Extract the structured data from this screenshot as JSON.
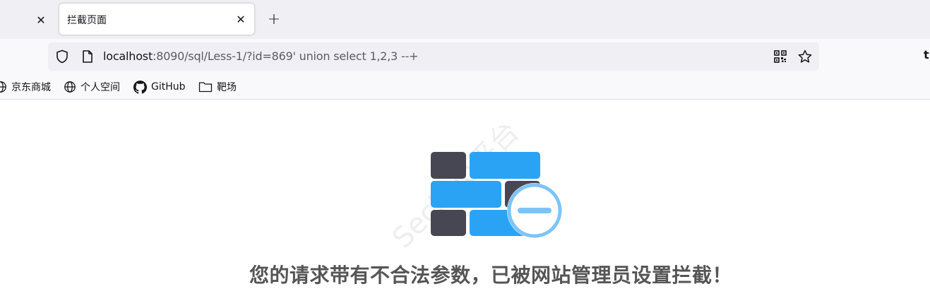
{
  "browser": {
    "tabs": [
      {
        "title": "拦截页面",
        "active": true
      }
    ],
    "url": {
      "host": "localhost",
      "rest": ":8090/sql/Less-1/?id=869' union select 1,2,3 --+"
    },
    "bookmarks": [
      {
        "label": "京东商城",
        "icon": "globe-icon"
      },
      {
        "label": "个人空间",
        "icon": "globe-icon"
      },
      {
        "label": "GitHub",
        "icon": "github-icon"
      },
      {
        "label": "靶场",
        "icon": "folder-icon"
      }
    ]
  },
  "page": {
    "watermark": "SecHub平台",
    "message": "您的请求带有不合法参数，已被网站管理员设置拦截！",
    "illustration": "firewall-block-icon"
  },
  "colors": {
    "accent_blue": "#2aa3f5",
    "dark_brick": "#474754",
    "badge_ring": "#7cc4f8",
    "message_text": "#555555"
  }
}
